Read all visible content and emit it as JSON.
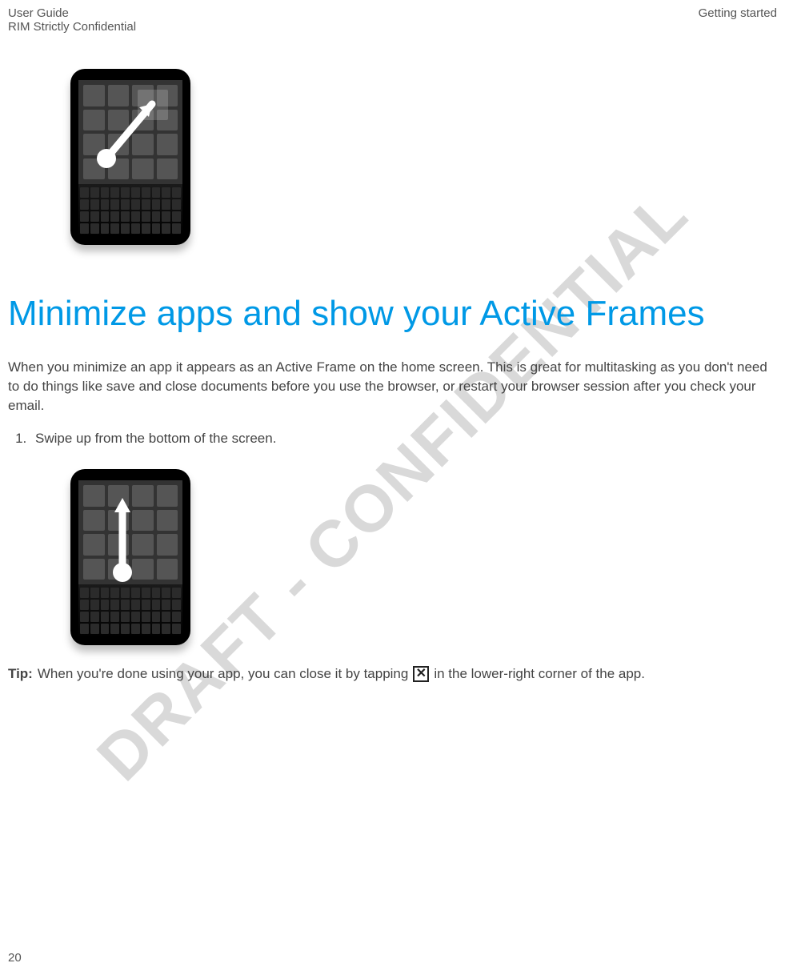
{
  "header": {
    "left_line1": "User Guide",
    "left_line2": "RIM Strictly Confidential",
    "right": "Getting started"
  },
  "watermark": "DRAFT - CONFIDENTIAL",
  "title": "Minimize apps and show your Active Frames",
  "intro": "When you minimize an app it appears as an Active Frame on the home screen. This is great for multitasking as you don't need to do things like save and close documents before you use the browser, or restart your browser session after you check your email.",
  "step1": "Swipe up from the bottom of the screen.",
  "tip": {
    "label": "Tip:",
    "before_icon": "When you're done using your app, you can close it by tapping",
    "after_icon": "in the lower-right corner of the app."
  },
  "close_icon_name": "close-icon",
  "page_number": "20"
}
